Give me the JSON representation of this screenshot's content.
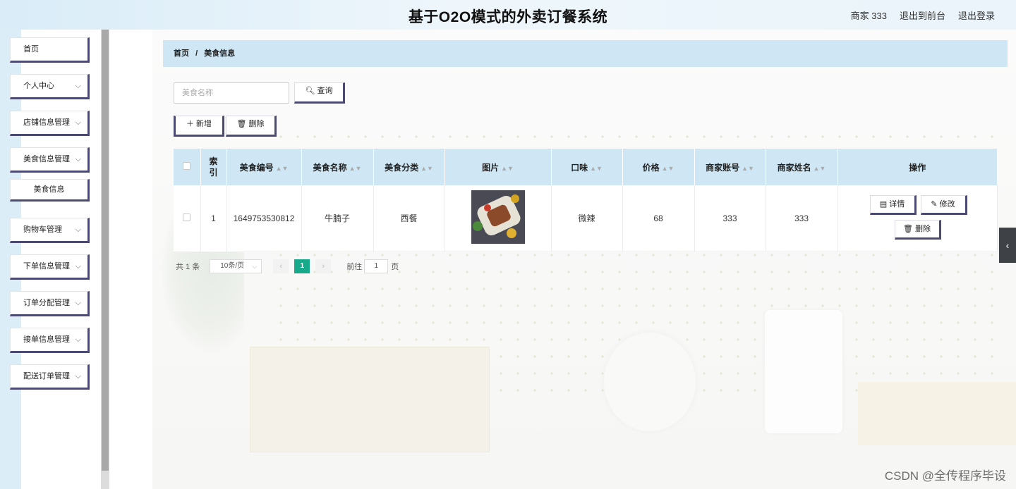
{
  "header": {
    "title": "基于O2O模式的外卖订餐系统",
    "user": "商家 333",
    "back_front": "退出到前台",
    "logout": "退出登录"
  },
  "sidebar": {
    "items": [
      {
        "label": "首页",
        "has_chevron": false
      },
      {
        "label": "个人中心",
        "has_chevron": true
      },
      {
        "label": "店铺信息管理",
        "has_chevron": true
      },
      {
        "label": "美食信息管理",
        "has_chevron": true
      },
      {
        "label": "购物车管理",
        "has_chevron": true
      },
      {
        "label": "下单信息管理",
        "has_chevron": true
      },
      {
        "label": "订单分配管理",
        "has_chevron": true
      },
      {
        "label": "接单信息管理",
        "has_chevron": true
      },
      {
        "label": "配送订单管理",
        "has_chevron": true
      }
    ],
    "sub_item": "美食信息"
  },
  "breadcrumb": {
    "home": "首页",
    "separator": "/",
    "current": "美食信息"
  },
  "search": {
    "placeholder": "美食名称",
    "query_label": "查询"
  },
  "toolbar": {
    "add_label": "新增",
    "delete_label": "删除"
  },
  "table": {
    "headers": [
      "索引",
      "美食编号",
      "美食名称",
      "美食分类",
      "图片",
      "口味",
      "价格",
      "商家账号",
      "商家姓名",
      "操作"
    ],
    "rows": [
      {
        "index": "1",
        "code": "1649753530812",
        "name": "牛腩子",
        "category": "西餐",
        "image": "food-tray-image",
        "taste": "微辣",
        "price": "68",
        "merchant_account": "333",
        "merchant_name": "333",
        "actions": {
          "detail": "详情",
          "edit": "修改",
          "delete": "删除"
        }
      }
    ]
  },
  "pagination": {
    "total": "共 1 条",
    "page_size": "10条/页",
    "current_page": "1",
    "goto_label": "前往",
    "goto_value": "1",
    "page_suffix": "页"
  },
  "watermark": "CSDN @全传程序毕设",
  "colors": {
    "accent": "#17a98a",
    "header_bg": "#cfe7f4",
    "button_border": "#4a4a72"
  }
}
